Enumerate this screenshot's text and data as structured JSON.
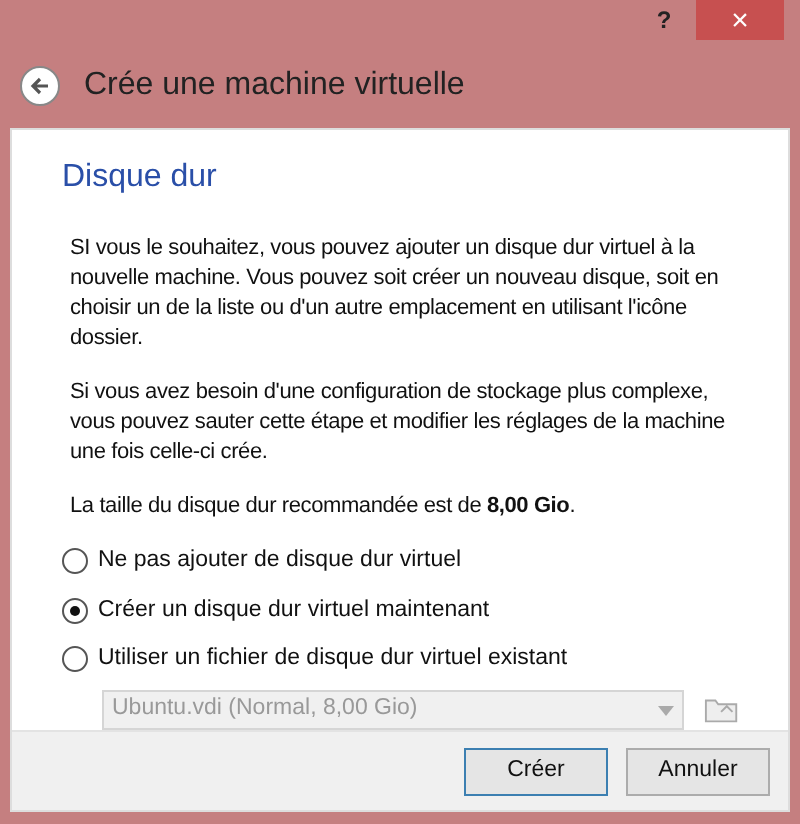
{
  "title_bar": {
    "help": "?",
    "close": "×"
  },
  "header": {
    "title": "Crée une machine virtuelle"
  },
  "page": {
    "heading": "Disque dur",
    "paragraphs": [
      "SI vous le souhaitez, vous pouvez ajouter un disque dur virtuel à la nouvelle machine. Vous pouvez soit créer un nouveau disque, soit en choisir un de la liste ou d'un autre emplacement en utilisant l'icône dossier.",
      "Si vous avez besoin d'une configuration de stockage plus complexe, vous pouvez sauter cette étape et modifier les réglages de la machine une fois celle-ci crée.",
      "La taille du disque dur recommandée est de **8,00 Gio**."
    ],
    "options": [
      {
        "label": "Ne pas ajouter de disque dur virtuel",
        "selected": false
      },
      {
        "label": "Créer un disque dur virtuel maintenant",
        "selected": true
      },
      {
        "label": "Utiliser un fichier de disque dur virtuel existant",
        "selected": false
      }
    ],
    "disk_select": {
      "value": "Ubuntu.vdi (Normal, 8,00 Gio)",
      "disabled": true
    }
  },
  "buttons": [
    {
      "label": "Créer",
      "default": true
    },
    {
      "label": "Annuler",
      "default": false
    }
  ]
}
